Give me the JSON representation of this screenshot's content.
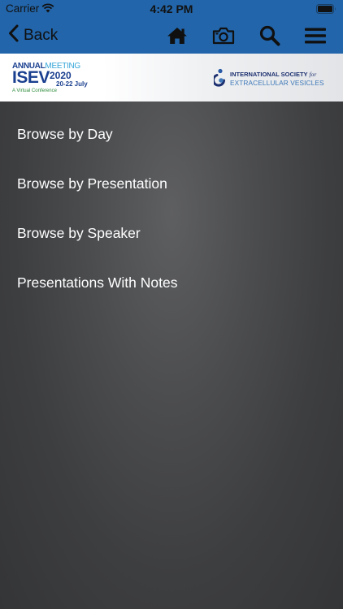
{
  "status_bar": {
    "carrier": "Carrier",
    "time": "4:42 PM"
  },
  "nav": {
    "back_label": "Back",
    "icons": [
      "home-icon",
      "camera-icon",
      "search-icon",
      "menu-icon"
    ]
  },
  "banner": {
    "isev": {
      "annual": "ANNUAL",
      "meeting": "MEETING",
      "acronym": "ISEV",
      "year": "2020",
      "dates": "20-22 July",
      "subtitle": "A Virtual Conference"
    },
    "society": {
      "line1": "INTERNATIONAL SOCIETY",
      "line1_suffix": "for",
      "line2": "EXTRACELLULAR VESICLES"
    }
  },
  "menu": {
    "items": [
      {
        "label": "Browse by Day"
      },
      {
        "label": "Browse by Presentation"
      },
      {
        "label": "Browse by Speaker"
      },
      {
        "label": "Presentations With Notes"
      }
    ]
  },
  "colors": {
    "header_blue": "#2265aa",
    "content_dark": "#3a3b3d",
    "menu_text": "#ffffff",
    "logo_navy": "#1a3f8f",
    "logo_cyan": "#34a5d8",
    "logo_green": "#2f8d3d"
  }
}
